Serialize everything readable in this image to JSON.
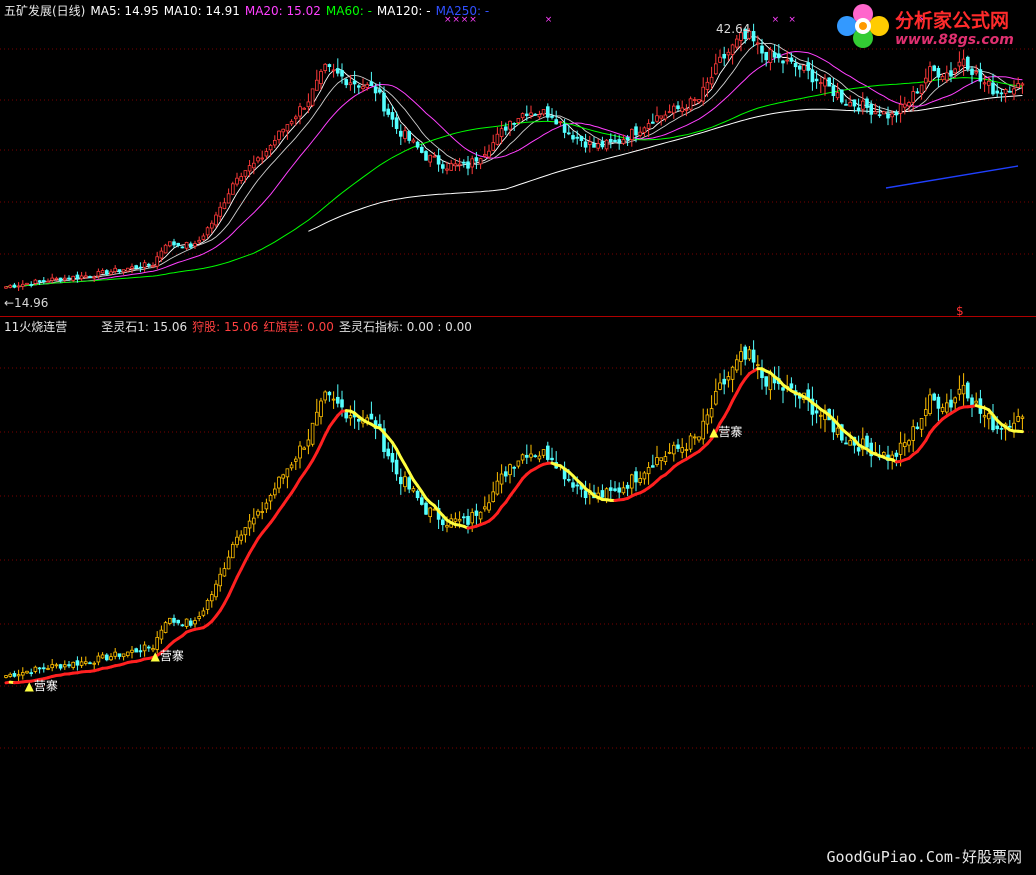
{
  "colors": {
    "bull": "#ff3a3a",
    "bear": "#54ffff",
    "ma5": "#ffffff",
    "ma10": "#ffffff",
    "ma20": "#ff40ff",
    "ma60": "#00ff00",
    "ma120": "#ffffff",
    "ma250": "#2040ff",
    "gold": "#ffbf00",
    "yellow": "#ffff40",
    "red": "#ff2020",
    "grid": "#7a0000"
  },
  "top_panel": {
    "stock": "五矿发展(日线)",
    "legend": [
      {
        "key": "ma5",
        "text": "MA5: 14.95"
      },
      {
        "key": "ma10",
        "text": "MA10: 14.91"
      },
      {
        "key": "ma20",
        "text": "MA20: 15.02"
      },
      {
        "key": "ma60",
        "text": "MA60: -"
      },
      {
        "key": "ma120",
        "text": "MA120: -"
      },
      {
        "key": "ma250",
        "text": "MA250: -"
      }
    ],
    "high_label": "42.64",
    "low_label": "←14.96"
  },
  "bottom_panel": {
    "title": "11火烧连营",
    "legend": [
      {
        "text": "圣灵石1: 15.06",
        "color": "#e0e0e0"
      },
      {
        "text": "狩股: 15.06",
        "color": "#ff4040"
      },
      {
        "text": "红旗营: 0.00",
        "color": "#ff4040"
      },
      {
        "text": "圣灵石指标: 0.00 : 0.00",
        "color": "#e0e0e0"
      }
    ],
    "signal_label": "营寨",
    "signal_arrow": "▲",
    "marker": "$"
  },
  "watermark": {
    "brand": "分析家公式网",
    "url": "www.88gs.com"
  },
  "footer": "GoodGuPiao.Com-好股票网",
  "chart_data": {
    "type": "candlestick",
    "price_range": {
      "low": 14.96,
      "high": 42.64
    },
    "anchors": [
      [
        0,
        15.2
      ],
      [
        10,
        15.9
      ],
      [
        20,
        16.4
      ],
      [
        30,
        17.2
      ],
      [
        35,
        17.6
      ],
      [
        38,
        19.8
      ],
      [
        45,
        19.5
      ],
      [
        50,
        22.6
      ],
      [
        55,
        27.0
      ],
      [
        60,
        28.4
      ],
      [
        66,
        31.9
      ],
      [
        72,
        35.0
      ],
      [
        76,
        38.2
      ],
      [
        82,
        37.0
      ],
      [
        88,
        36.0
      ],
      [
        93,
        32.0
      ],
      [
        100,
        29.0
      ],
      [
        105,
        28.0
      ],
      [
        110,
        28.0
      ],
      [
        116,
        30.4
      ],
      [
        120,
        32.7
      ],
      [
        124,
        33.8
      ],
      [
        130,
        33.5
      ],
      [
        134,
        31.5
      ],
      [
        140,
        30.0
      ],
      [
        145,
        30.4
      ],
      [
        150,
        31.7
      ],
      [
        154,
        33.0
      ],
      [
        160,
        34.0
      ],
      [
        165,
        35.0
      ],
      [
        170,
        39.0
      ],
      [
        176,
        42.0
      ],
      [
        180,
        40.0
      ],
      [
        184,
        39.2
      ],
      [
        190,
        38.1
      ],
      [
        196,
        36.2
      ],
      [
        200,
        34.8
      ],
      [
        206,
        34.0
      ],
      [
        211,
        33.2
      ],
      [
        215,
        34.8
      ],
      [
        220,
        38.0
      ],
      [
        225,
        37.8
      ],
      [
        228,
        39.5
      ],
      [
        232,
        37.0
      ],
      [
        236,
        35.8
      ],
      [
        240,
        36.6
      ],
      [
        242,
        36.2
      ]
    ],
    "n": 243,
    "high_index": 176,
    "signals": [
      3,
      33,
      166
    ]
  }
}
